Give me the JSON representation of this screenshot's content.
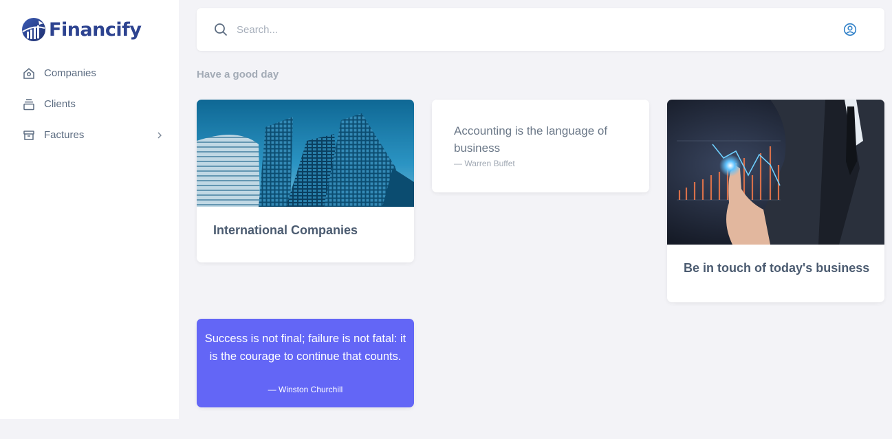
{
  "app": {
    "name": "Financify"
  },
  "sidebar": {
    "items": [
      {
        "label": "Companies",
        "icon": "home-icon"
      },
      {
        "label": "Clients",
        "icon": "stack-icon"
      },
      {
        "label": "Factures",
        "icon": "archive-icon",
        "has_submenu": true
      }
    ]
  },
  "search": {
    "placeholder": "Search...",
    "value": ""
  },
  "greeting": "Have a good day",
  "cards": {
    "international": {
      "title": "International Companies",
      "image": "buildings-photo"
    },
    "quote1": {
      "text": "Accounting is the language of business",
      "author": "— Warren Buffet"
    },
    "business": {
      "title": "Be in touch of today's business",
      "image": "businessman-chart-photo"
    },
    "quote2": {
      "text": "Success is not final; failure is not fatal: it is the courage to continue that counts.",
      "author": "— Winston Churchill"
    }
  },
  "colors": {
    "brand": "#2d4390",
    "accent_card": "#6366f6",
    "background": "#f3f3f7",
    "nav_text": "#5b6b80",
    "icon_blue": "#2f80c8"
  }
}
